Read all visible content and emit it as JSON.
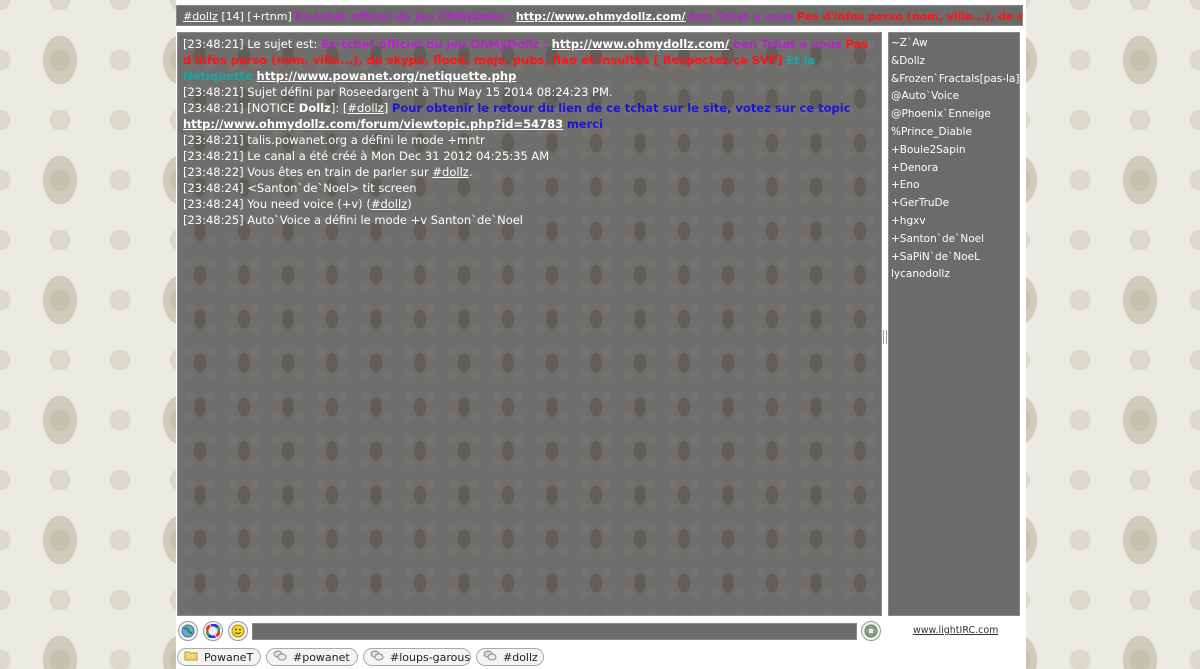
{
  "topic_bar": {
    "channel": "#dollz",
    "count": "[14]",
    "modes": "[+rtnm]",
    "topic_purple": "Ex-tchat officiel du jeu OhMyDollz :",
    "topic_link": "http://www.ohmydollz.com/",
    "topic_rest": "bon Tchat a vous",
    "topic_red": "Pas d'infos perso (nom, ville...), de skype, flood,"
  },
  "chat": {
    "l1": {
      "ts": "[23:48:21]",
      "prefix": "Le sujet est:",
      "purple": "Ex-tchat officiel du jeu OhMyDollz :",
      "link": "http://www.ohmydollz.com/",
      "purple2": "bon Tchat a vous",
      "red": "Pas d'infos perso (nom, ville...), de skype, flood, majs, pubs, flao et insultes [ Respectez ça SVP]",
      "teal": "Et la Nétiquette",
      "link2": "http://www.powanet.org/netiquette.php"
    },
    "l2": {
      "ts": "[23:48:21]",
      "text": "Sujet défini par Roseedargent à Thu May 15 2014 08:24:23 PM."
    },
    "l3": {
      "ts": "[23:48:21]",
      "notice": "[NOTICE",
      "nick": "Dollz",
      "after": "]: [",
      "chan": "#dollz",
      "close": "]",
      "blue": "Pour obtenir le retour du lien de ce tchat sur le site, votez sur ce topic",
      "link": "http://www.ohmydollz.com/forum/viewtopic.php?id=54783",
      "blue2": "merci"
    },
    "l4": {
      "ts": "[23:48:21]",
      "text": "talis.powanet.org a défini le mode +mntr"
    },
    "l5": {
      "ts": "[23:48:21]",
      "text": "Le canal a été créé à Mon Dec 31 2012 04:25:35 AM"
    },
    "l6": {
      "ts": "[23:48:22]",
      "text": "Vous êtes en train de parler sur",
      "chan": "#dollz",
      "end": "."
    },
    "l7": {
      "ts": "[23:48:24]",
      "text": "<Santon`de`Noel> tit screen"
    },
    "l8": {
      "ts": "[23:48:24]",
      "text": "You need voice (+v) (",
      "chan": "#dollz",
      "end": ")"
    },
    "l9": {
      "ts": "[23:48:25]",
      "text": "Auto`Voice a défini le mode +v Santon`de`Noel"
    }
  },
  "users": [
    "~Z`Aw",
    "&Dollz",
    "&Frozen`Fractals[pas-la]",
    "@Auto`Voice",
    "@Phoenix`Enneige",
    "%Prince_Diable",
    "+Boule2Sapin",
    "+Denora",
    "+Eno",
    "+GerTruDe",
    "+hgxv",
    "+Santon`de`Noel",
    "+SaPiN`de`NoeL",
    "lycanodollz"
  ],
  "input": {
    "value": ""
  },
  "brand": "www.lightIRC.com",
  "tabs": [
    "PowaneT",
    "#powanet",
    "#loups-garous",
    "#dollz"
  ]
}
